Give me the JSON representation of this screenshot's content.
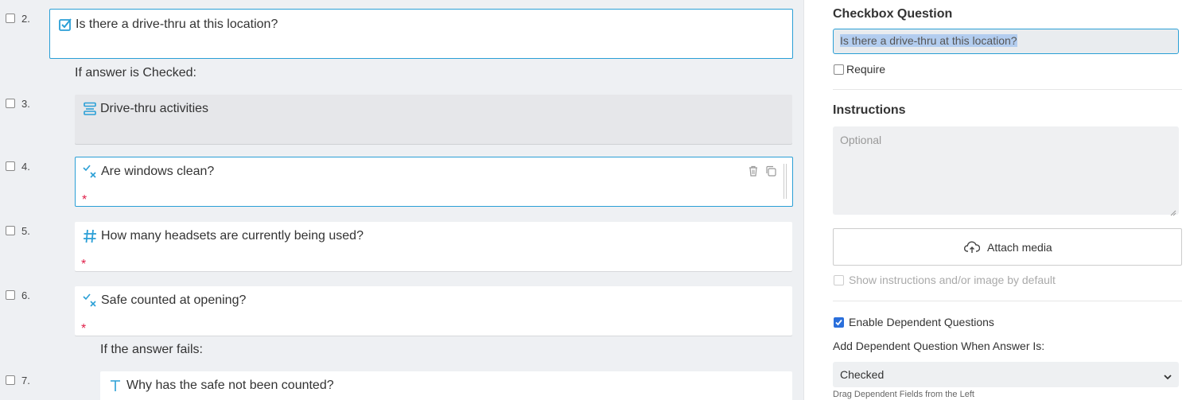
{
  "questions": [
    {
      "num": "2.",
      "text": "Is there a drive-thru at this location?",
      "icon": "checkbox-icon"
    },
    {
      "num": "3.",
      "text": "Drive-thru activities",
      "icon": "section-icon"
    },
    {
      "num": "4.",
      "text": "Are windows clean?",
      "icon": "pass-fail-icon",
      "required": "*"
    },
    {
      "num": "5.",
      "text": "How many headsets are currently being used?",
      "icon": "number-icon",
      "required": "*"
    },
    {
      "num": "6.",
      "text": "Safe counted at opening?",
      "icon": "pass-fail-icon",
      "required": "*"
    },
    {
      "num": "7.",
      "text": "Why has the safe not been counted?",
      "icon": "text-icon"
    }
  ],
  "conditions": {
    "checked": "If answer is Checked:",
    "fails": "If the answer fails:"
  },
  "panel": {
    "title": "Checkbox Question",
    "question_value": "Is there a drive-thru at this location?",
    "require_label": "Require",
    "instructions_heading": "Instructions",
    "instructions_placeholder": "Optional",
    "attach_label": "Attach media",
    "show_instructions_label": "Show instructions and/or image by default",
    "enable_dependent_label": "Enable Dependent Questions",
    "add_dependent_label": "Add Dependent Question When Answer Is:",
    "dependent_select_value": "Checked",
    "drag_hint": "Drag Dependent Fields from the Left"
  },
  "colors": {
    "accent": "#2a9fd6",
    "required": "#e0204a",
    "checkbox_checked": "#2a6fdb"
  }
}
